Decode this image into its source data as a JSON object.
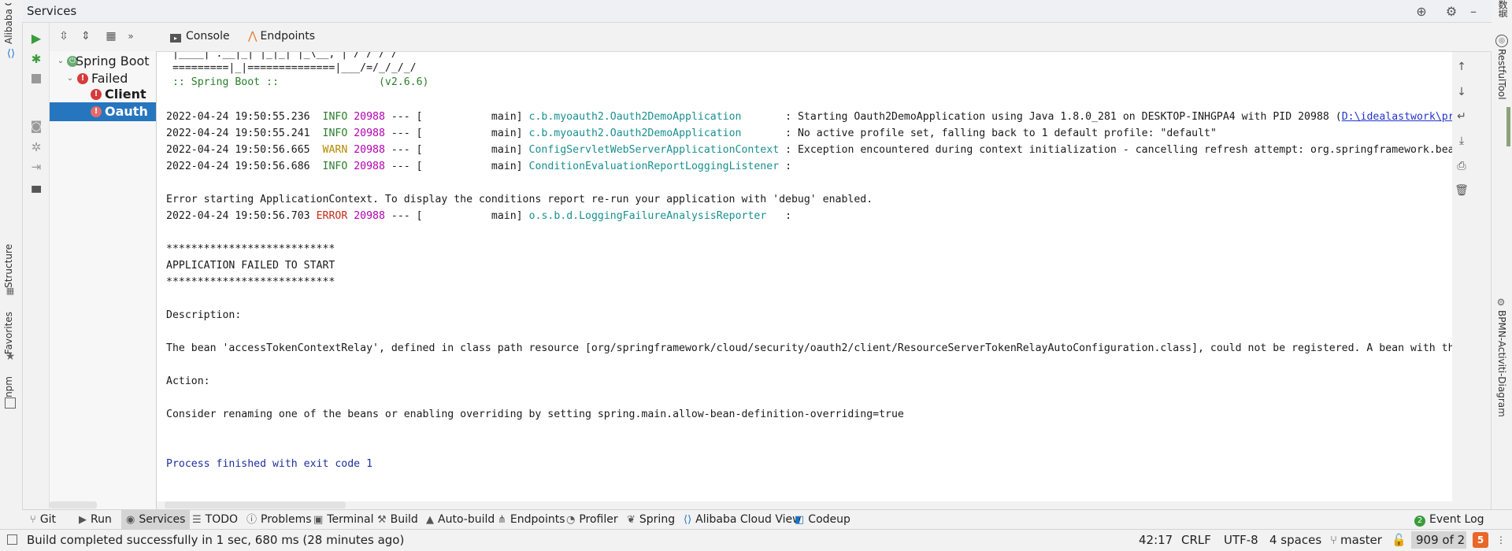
{
  "left_strip": {
    "top_label": "Alibaba Clo",
    "structure_label": "Structure",
    "favorites_label": "Favorites",
    "npm_label": "npm"
  },
  "right_strip": {
    "top_label": "数据库",
    "restful_label": "RestfulTool",
    "bpmn_label": "BPMN-Activiti-Diagram"
  },
  "services": {
    "title": "Services",
    "tree": [
      {
        "label": "Spring Boot",
        "level": 0
      },
      {
        "label": "Failed",
        "level": 1
      },
      {
        "label": "Client",
        "level": 2
      },
      {
        "label": "Oauth",
        "level": 2,
        "selected": true
      }
    ]
  },
  "console_tabs": {
    "console": "Console",
    "endpoints": "Endpoints"
  },
  "console": {
    "banner_line1": " |____| .__|_| |_|_| |_\\__, | / / / /",
    "banner_line2": " =========|_|==============|___/=/_/_/_/",
    "banner_line3": " :: Spring Boot ::                (v2.6.6)",
    "log_lines": [
      {
        "ts": "2022-04-24 19:50:55.236",
        "level": "INFO ",
        "level_class": "info",
        "pid": "20988",
        "sep": " --- [           main] ",
        "logger": "c.b.myoauth2.Oauth2DemoApplication      ",
        "msg": " : Starting Oauth2DemoApplication using Java 1.8.0_281 on DESKTOP-INHGPA4 with PID 20988 (",
        "link": "D:\\idealastwork\\project"
      },
      {
        "ts": "2022-04-24 19:50:55.241",
        "level": "INFO ",
        "level_class": "info",
        "pid": "20988",
        "sep": " --- [           main] ",
        "logger": "c.b.myoauth2.Oauth2DemoApplication      ",
        "msg": " : No active profile set, falling back to 1 default profile: \"default\"",
        "link": ""
      },
      {
        "ts": "2022-04-24 19:50:56.665",
        "level": "WARN ",
        "level_class": "warn",
        "pid": "20988",
        "sep": " --- [           main] ",
        "logger": "ConfigServletWebServerApplicationContext",
        "msg": " : Exception encountered during context initialization - cancelling refresh attempt: org.springframework.beans",
        "link": ""
      },
      {
        "ts": "2022-04-24 19:50:56.686",
        "level": "INFO ",
        "level_class": "info",
        "pid": "20988",
        "sep": " --- [           main] ",
        "logger": "ConditionEvaluationReportLoggingListener",
        "msg": " :",
        "link": ""
      }
    ],
    "error_context": "Error starting ApplicationContext. To display the conditions report re-run your application with 'debug' enabled.",
    "error_line": {
      "ts": "2022-04-24 19:50:56.703",
      "level": "ERROR",
      "pid": "20988",
      "sep": " --- [           main] ",
      "logger": "o.s.b.d.LoggingFailureAnalysisReporter  ",
      "msg": " :"
    },
    "stars": "***************************",
    "failed": "APPLICATION FAILED TO START",
    "description_heading": "Description:",
    "description_text": "The bean 'accessTokenContextRelay', defined in class path resource [org/springframework/cloud/security/oauth2/client/ResourceServerTokenRelayAutoConfiguration.class], could not be registered. A bean with that",
    "action_heading": "Action:",
    "action_text": "Consider renaming one of the beans or enabling overriding by setting spring.main.allow-bean-definition-overriding=true",
    "exit_text": "Process finished with exit code 1"
  },
  "tool_windows": [
    {
      "label": "Git",
      "icon": "git-icon"
    },
    {
      "label": "Run",
      "icon": "run-icon"
    },
    {
      "label": "Services",
      "icon": "services-icon",
      "active": true
    },
    {
      "label": "TODO",
      "icon": "todo-icon"
    },
    {
      "label": "Problems",
      "icon": "problems-icon"
    },
    {
      "label": "Terminal",
      "icon": "terminal-icon"
    },
    {
      "label": "Build",
      "icon": "build-icon"
    },
    {
      "label": "Auto-build",
      "icon": "auto-build-icon"
    },
    {
      "label": "Endpoints",
      "icon": "endpoints-icon"
    },
    {
      "label": "Profiler",
      "icon": "profiler-icon"
    },
    {
      "label": "Spring",
      "icon": "spring-icon"
    },
    {
      "label": "Alibaba Cloud View",
      "icon": "alibaba-cloud-icon"
    },
    {
      "label": "Codeup",
      "icon": "codeup-icon"
    }
  ],
  "event_log": {
    "label": "Event Log",
    "badge": "2"
  },
  "status": {
    "message": "Build completed successfully in 1 sec, 680 ms (28 minutes ago)",
    "position": "42:17",
    "line_sep": "CRLF",
    "encoding": "UTF-8",
    "indent": "4 spaces",
    "branch": "master",
    "memory": "909 of 2"
  },
  "colors": {
    "selection": "#2675bf",
    "run_green": "#3a9c3a",
    "error_red": "#d83b3b",
    "info_green": "#2a7e2a",
    "warn_yellow": "#b58a00",
    "pid_magenta": "#b200b2",
    "logger_teal": "#1a8f8f"
  }
}
